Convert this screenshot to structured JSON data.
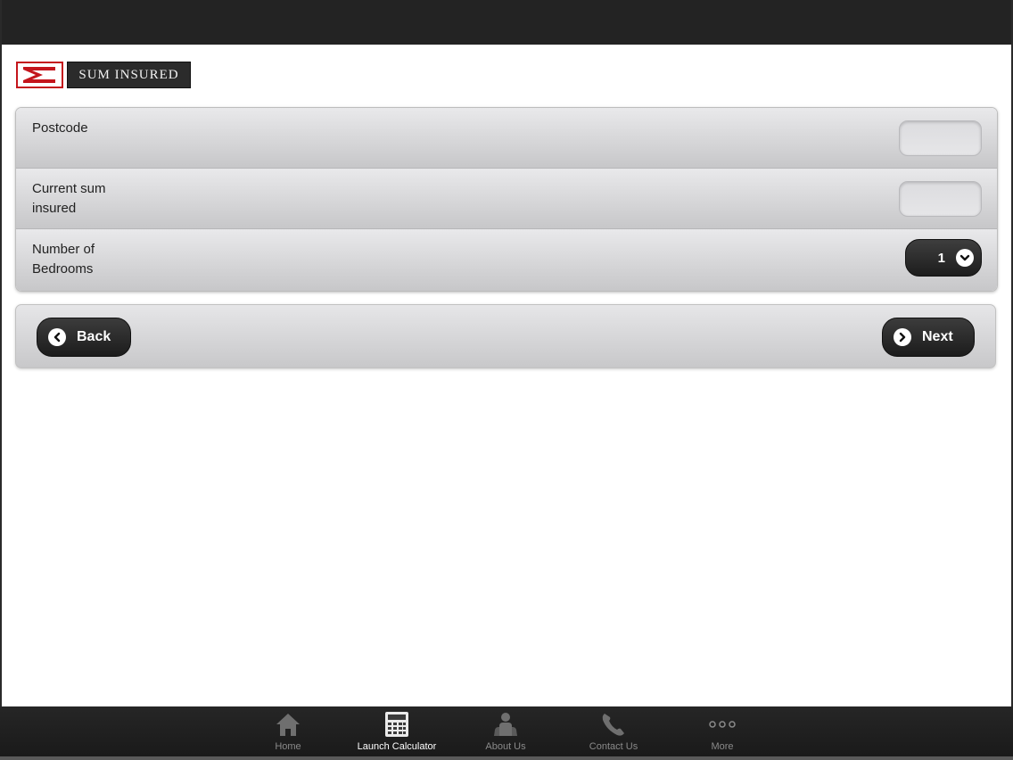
{
  "app": {
    "logo_text": "SUM INSURED"
  },
  "form": {
    "rows": [
      {
        "label": "Postcode",
        "value": ""
      },
      {
        "label": "Current sum insured",
        "value": ""
      },
      {
        "label": "Number of Bedrooms",
        "selected": "1"
      }
    ]
  },
  "navigation": {
    "back_label": "Back",
    "next_label": "Next"
  },
  "tabs": [
    {
      "label": "Home",
      "icon": "home-icon",
      "active": false
    },
    {
      "label": "Launch Calculator",
      "icon": "calculator-icon",
      "active": true
    },
    {
      "label": "About Us",
      "icon": "people-icon",
      "active": false
    },
    {
      "label": "Contact Us",
      "icon": "phone-icon",
      "active": false
    },
    {
      "label": "More",
      "icon": "more-icon",
      "active": false
    }
  ],
  "colors": {
    "brand_red": "#c4151c",
    "bar_dark": "#232323"
  }
}
